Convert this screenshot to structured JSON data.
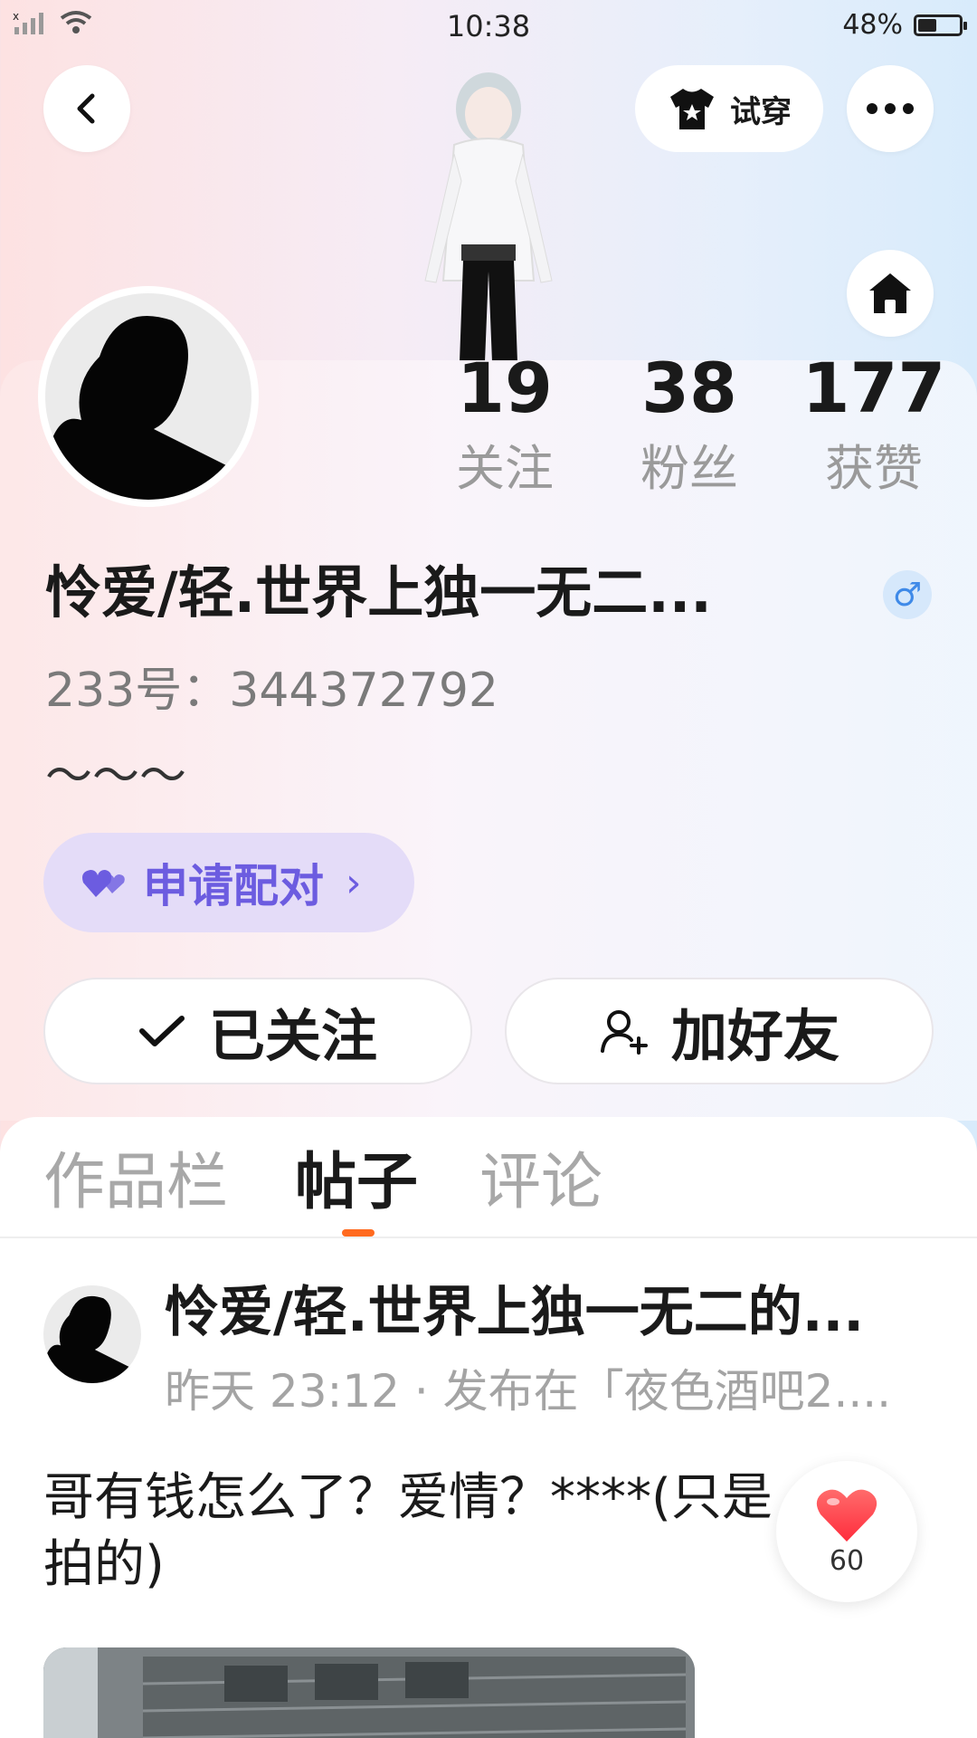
{
  "status_bar": {
    "time": "10:38",
    "battery_text": "48%",
    "battery_level": 0.48
  },
  "header": {
    "tryon_label": "试穿",
    "back_icon": "chevron-left-icon",
    "more_icon": "more-dots-icon",
    "home_icon": "home-icon",
    "tryon_icon": "tshirt-icon"
  },
  "profile": {
    "stats": [
      {
        "value": "19",
        "label": "关注"
      },
      {
        "value": "38",
        "label": "粉丝"
      },
      {
        "value": "177",
        "label": "获赞"
      }
    ],
    "name": "怜爱/轻.世界上独一无二...",
    "gender_symbol": "♂",
    "uid": "233号：344372792",
    "bio": "〜〜〜",
    "pair_label": "申请配对",
    "pair_chevron": "›",
    "follow_label": "已关注",
    "add_friend_label": "加好友"
  },
  "tabs": [
    {
      "label": "作品栏",
      "active": false
    },
    {
      "label": "帖子",
      "active": true
    },
    {
      "label": "评论",
      "active": false
    }
  ],
  "post": {
    "author": "怜爱/轻.世界上独一无二的...",
    "meta": "昨天 23:12 · 发布在「夜色酒吧2....",
    "text": "哥有钱怎么了？爱情？****(只是拍的)",
    "like_count": "60"
  },
  "colors": {
    "accent_orange": "#ff6a1f",
    "pair_purple": "#6c5ce0",
    "pair_bg": "#e4dcf8",
    "gender_blue": "#3f8ae8",
    "like_red": "#ff3b45"
  }
}
